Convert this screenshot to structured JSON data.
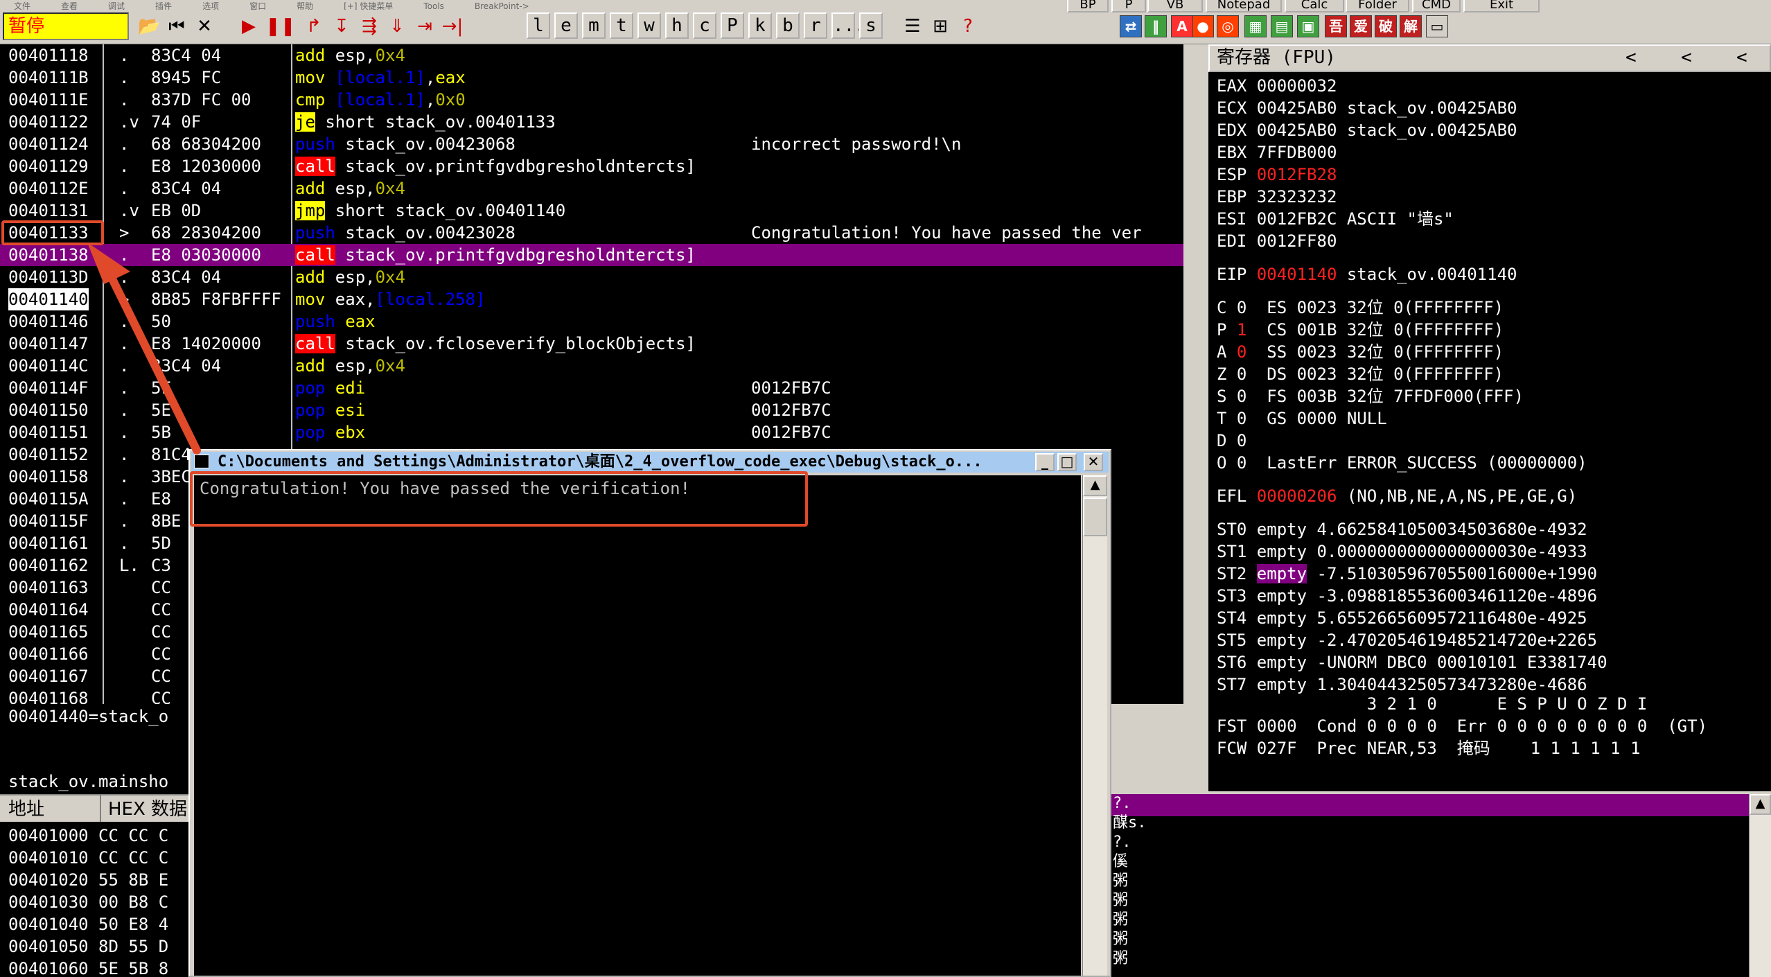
{
  "toolbar": {
    "status": "暂停",
    "menu": [
      "文件",
      "查看",
      "调试",
      "插件",
      "选项",
      "窗口",
      "帮助",
      "[+] 快捷菜单",
      "Tools",
      "BreakPoint->"
    ],
    "controls": [
      "▶",
      "❚❚",
      "↱",
      "↧",
      "⇶",
      "⇓",
      "⇥",
      "→|"
    ],
    "letters": [
      "l",
      "e",
      "m",
      "t",
      "w",
      "h",
      "c",
      "P",
      "k",
      "b",
      "r",
      "...",
      "s"
    ],
    "top_buttons": [
      "BP",
      "P",
      "VB",
      "Notepad",
      "Calc",
      "Folder",
      "CMD",
      "Exit"
    ],
    "plugin_icons": [
      "A",
      "吾",
      "爱",
      "破",
      "解"
    ]
  },
  "disasm": {
    "rows": [
      {
        "addr": "00401118",
        "mark": ".",
        "hex": "83C4 04",
        "asm": [
          [
            "add",
            "y"
          ],
          [
            " esp,",
            "w"
          ],
          [
            "0x4",
            "n"
          ]
        ],
        "comment": ""
      },
      {
        "addr": "0040111B",
        "mark": ".",
        "hex": "8945 FC",
        "asm": [
          [
            "mov",
            "y"
          ],
          [
            " ",
            "w"
          ],
          [
            "[local.1]",
            "b"
          ],
          [
            ",",
            "w"
          ],
          [
            "eax",
            "y"
          ]
        ],
        "comment": ""
      },
      {
        "addr": "0040111E",
        "mark": ".",
        "hex": "837D FC 00",
        "asm": [
          [
            "cmp",
            "y"
          ],
          [
            " ",
            "w"
          ],
          [
            "[local.1]",
            "b"
          ],
          [
            ",",
            "w"
          ],
          [
            "0x0",
            "n"
          ]
        ],
        "comment": ""
      },
      {
        "addr": "00401122",
        "mark": ".v",
        "hex": "74 0F",
        "asm": [
          [
            "je",
            "jmp"
          ],
          [
            " short stack_ov.00401133",
            "w"
          ]
        ],
        "comment": ""
      },
      {
        "addr": "00401124",
        "mark": ".",
        "hex": "68 68304200",
        "asm": [
          [
            "push",
            "b"
          ],
          [
            " stack_ov.00423068",
            "w"
          ]
        ],
        "comment": "incorrect password!\\n"
      },
      {
        "addr": "00401129",
        "mark": ".",
        "hex": "E8 12030000",
        "asm": [
          [
            "call",
            "call"
          ],
          [
            " stack_ov.printfgvdbgresholdntercts]",
            "w"
          ]
        ],
        "comment": ""
      },
      {
        "addr": "0040112E",
        "mark": ".",
        "hex": "83C4 04",
        "asm": [
          [
            "add",
            "y"
          ],
          [
            " esp,",
            "w"
          ],
          [
            "0x4",
            "n"
          ]
        ],
        "comment": ""
      },
      {
        "addr": "00401131",
        "mark": ".v",
        "hex": "EB 0D",
        "asm": [
          [
            "jmp",
            "jmp"
          ],
          [
            " short stack_ov.00401140",
            "w"
          ]
        ],
        "comment": ""
      },
      {
        "addr": "00401133",
        "mark": ">",
        "hex": "68 28304200",
        "asm": [
          [
            "push",
            "b"
          ],
          [
            " stack_ov.00423028",
            "w"
          ]
        ],
        "comment": "Congratulation! You have passed the ver"
      },
      {
        "addr": "00401138",
        "mark": ".",
        "hex": "E8 03030000",
        "asm": [
          [
            "call",
            "call"
          ],
          [
            " stack_ov.printfgvdbgresholdntercts]",
            "w"
          ]
        ],
        "comment": ""
      },
      {
        "addr": "0040113D",
        "mark": ".",
        "hex": "83C4 04",
        "asm": [
          [
            "add",
            "y"
          ],
          [
            " esp,",
            "w"
          ],
          [
            "0x4",
            "n"
          ]
        ],
        "comment": ""
      },
      {
        "addr": "00401140",
        "mark": ">",
        "hex": "8B85 F8FBFFFF",
        "asm": [
          [
            "mov",
            "y"
          ],
          [
            " eax,",
            "w"
          ],
          [
            "[local.258]",
            "b"
          ]
        ],
        "comment": ""
      },
      {
        "addr": "00401146",
        "mark": ".",
        "hex": "50",
        "asm": [
          [
            "push",
            "b"
          ],
          [
            " ",
            "w"
          ],
          [
            "eax",
            "y"
          ]
        ],
        "comment": ""
      },
      {
        "addr": "00401147",
        "mark": ".",
        "hex": "E8 14020000",
        "asm": [
          [
            "call",
            "call"
          ],
          [
            " stack_ov.fcloseverify_blockObjects]",
            "w"
          ]
        ],
        "comment": ""
      },
      {
        "addr": "0040114C",
        "mark": ".",
        "hex": "83C4 04",
        "asm": [
          [
            "add",
            "y"
          ],
          [
            " esp,",
            "w"
          ],
          [
            "0x4",
            "n"
          ]
        ],
        "comment": ""
      },
      {
        "addr": "0040114F",
        "mark": ".",
        "hex": "5F",
        "asm": [
          [
            "pop",
            "b"
          ],
          [
            " ",
            "w"
          ],
          [
            "edi",
            "y"
          ]
        ],
        "comment": "0012FB7C"
      },
      {
        "addr": "00401150",
        "mark": ".",
        "hex": "5E",
        "asm": [
          [
            "pop",
            "b"
          ],
          [
            " ",
            "w"
          ],
          [
            "esi",
            "y"
          ]
        ],
        "comment": "0012FB7C"
      },
      {
        "addr": "00401151",
        "mark": ".",
        "hex": "5B",
        "asm": [
          [
            "pop",
            "b"
          ],
          [
            " ",
            "w"
          ],
          [
            "ebx",
            "y"
          ]
        ],
        "comment": "0012FB7C"
      },
      {
        "addr": "00401152",
        "mark": ".",
        "hex": "81C4",
        "asm": [],
        "comment": ""
      },
      {
        "addr": "00401158",
        "mark": ".",
        "hex": "3BEC",
        "asm": [],
        "comment": ""
      },
      {
        "addr": "0040115A",
        "mark": ".",
        "hex": "E8",
        "asm": [],
        "comment": ""
      },
      {
        "addr": "0040115F",
        "mark": ".",
        "hex": "8BE",
        "asm": [],
        "comment": ""
      },
      {
        "addr": "00401161",
        "mark": ".",
        "hex": "5D",
        "asm": [],
        "comment": ""
      },
      {
        "addr": "00401162",
        "mark": "L.",
        "hex": "C3",
        "asm": [],
        "comment": ""
      },
      {
        "addr": "00401163",
        "mark": "",
        "hex": "CC",
        "asm": [],
        "comment": ""
      },
      {
        "addr": "00401164",
        "mark": "",
        "hex": "CC",
        "asm": [],
        "comment": ""
      },
      {
        "addr": "00401165",
        "mark": "",
        "hex": "CC",
        "asm": [],
        "comment": ""
      },
      {
        "addr": "00401166",
        "mark": "",
        "hex": "CC",
        "asm": [],
        "comment": ""
      },
      {
        "addr": "00401167",
        "mark": "",
        "hex": "CC",
        "asm": [],
        "comment": ""
      },
      {
        "addr": "00401168",
        "mark": "",
        "hex": "CC",
        "asm": [],
        "comment": ""
      }
    ]
  },
  "registers": {
    "title": "寄存器 (FPU)",
    "nav": [
      "<",
      "<",
      "<"
    ],
    "lines": [
      [
        [
          "EAX 00000032",
          "w"
        ]
      ],
      [
        [
          "ECX 00425AB0 stack_ov.00425AB0",
          "w"
        ]
      ],
      [
        [
          "EDX 00425AB0 stack_ov.00425AB0",
          "w"
        ]
      ],
      [
        [
          "EBX 7FFDB000",
          "w"
        ]
      ],
      [
        [
          "ESP ",
          "w"
        ],
        [
          "0012FB28",
          "r"
        ]
      ],
      [
        [
          "EBP 32323232",
          "w"
        ]
      ],
      [
        [
          "ESI 0012FB2C ASCII \"墙s\"",
          "w"
        ]
      ],
      [
        [
          "EDI 0012FF80",
          "w"
        ]
      ],
      [
        [
          "",
          "w"
        ]
      ],
      [
        [
          "EIP ",
          "w"
        ],
        [
          "00401140",
          "r"
        ],
        [
          " stack_ov.00401140",
          "w"
        ]
      ],
      [
        [
          "",
          "w"
        ]
      ],
      [
        [
          "C 0  ES 0023 32位 0(FFFFFFFF)",
          "w"
        ]
      ],
      [
        [
          "P ",
          "w"
        ],
        [
          "1",
          "r"
        ],
        [
          "  CS 001B 32位 0(FFFFFFFF)",
          "w"
        ]
      ],
      [
        [
          "A ",
          "w"
        ],
        [
          "0",
          "r"
        ],
        [
          "  SS 0023 32位 0(FFFFFFFF)",
          "w"
        ]
      ],
      [
        [
          "Z 0  DS 0023 32位 0(FFFFFFFF)",
          "w"
        ]
      ],
      [
        [
          "S 0  FS 003B 32位 7FFDF000(FFF)",
          "w"
        ]
      ],
      [
        [
          "T 0  GS 0000 NULL",
          "w"
        ]
      ],
      [
        [
          "D 0",
          "w"
        ]
      ],
      [
        [
          "O 0  LastErr ERROR_SUCCESS (00000000)",
          "w"
        ]
      ],
      [
        [
          "",
          "w"
        ]
      ],
      [
        [
          "EFL ",
          "w"
        ],
        [
          "00000206",
          "r"
        ],
        [
          " (NO,NB,NE,A,NS,PE,GE,G)",
          "w"
        ]
      ],
      [
        [
          "",
          "w"
        ]
      ],
      [
        [
          "ST0 empty 4.6625841050034503680e-4932",
          "w"
        ]
      ],
      [
        [
          "ST1 empty 0.0000000000000000030e-4933",
          "w"
        ]
      ],
      [
        [
          "ST2 ",
          "w"
        ],
        [
          "empty",
          "p"
        ],
        [
          " -7.5103059670550016000e+1990",
          "w"
        ]
      ],
      [
        [
          "ST3 empty -3.0988185536003461120e-4896",
          "w"
        ]
      ],
      [
        [
          "ST4 empty 5.6552665609572116480e-4925",
          "w"
        ]
      ],
      [
        [
          "ST5 empty -2.4702054619485214720e+2265",
          "w"
        ]
      ],
      [
        [
          "ST6 empty -UNORM DBC0 00010101 E3381740",
          "w"
        ]
      ],
      [
        [
          "ST7 empty 1.3040443250573473280e-4686",
          "w"
        ]
      ],
      [
        [
          "               3 2 1 0      E S P U O Z D I",
          "w"
        ]
      ],
      [
        [
          "FST 0000  Cond 0 0 0 0  Err 0 0 0 0 0 0 0 0  (GT)",
          "w"
        ]
      ],
      [
        [
          "FCW 027F  Prec NEAR,53  掩码    1 1 1 1 1 1",
          "w"
        ]
      ]
    ]
  },
  "info": {
    "line1": "00401440=stack_o",
    "line2": "stack_ov.mainsho"
  },
  "dump": {
    "col_addr": "地址",
    "col_hex": "HEX 数据",
    "rows": [
      "00401000 CC CC C",
      "00401010 CC CC C",
      "00401020 55 8B E",
      "00401030 00 B8 C",
      "00401040 50 E8 4",
      "00401050 8D 55 D",
      "00401060 5E 5B 8"
    ]
  },
  "stack": {
    "rows": [
      "?.",
      "䤂s.",
      "?.",
      "傒",
      "粥",
      "粥",
      "粥",
      "粥",
      "粥"
    ]
  },
  "console": {
    "title": "C:\\Documents and Settings\\Administrator\\桌面\\2_4_overflow_code_exec\\Debug\\stack_o...",
    "output": "Congratulation! You have passed the verification!"
  },
  "colors": {
    "annotation": "#e04a2a",
    "selection": "#800080",
    "call_bg": "#ff0000",
    "jmp_bg": "#ffff00"
  }
}
